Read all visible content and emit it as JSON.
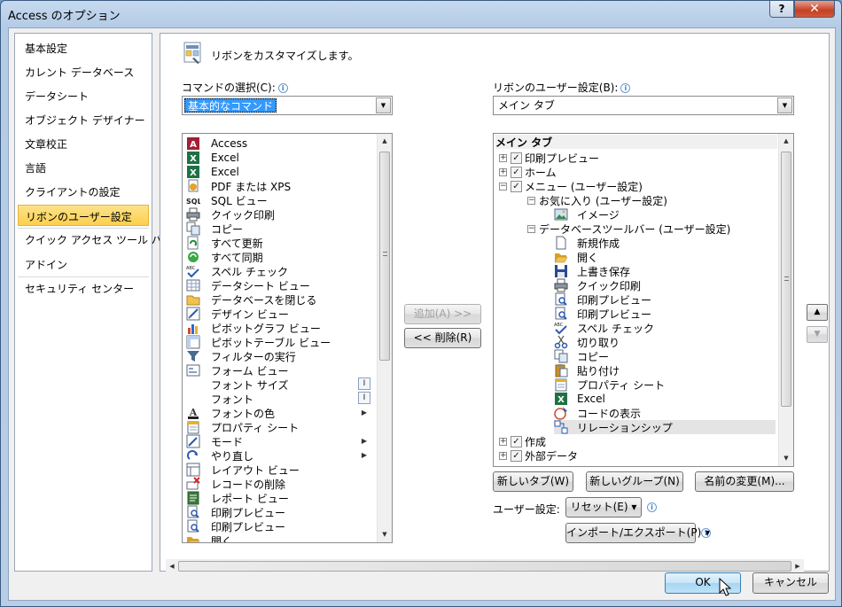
{
  "window": {
    "title": "Access のオプション",
    "help": "?",
    "close": "✕"
  },
  "nav": {
    "items": [
      {
        "label": "基本設定",
        "selected": false
      },
      {
        "label": "カレント データベース",
        "selected": false
      },
      {
        "label": "データシート",
        "selected": false
      },
      {
        "label": "オブジェクト デザイナー",
        "selected": false
      },
      {
        "label": "文章校正",
        "selected": false
      },
      {
        "label": "言語",
        "selected": false
      },
      {
        "label": "クライアントの設定",
        "selected": false
      },
      {
        "label": "リボンのユーザー設定",
        "selected": true
      },
      {
        "label": "クイック アクセス ツール バー",
        "selected": false
      },
      {
        "label": "アドイン",
        "selected": false
      },
      {
        "label": "セキュリティ センター",
        "selected": false
      }
    ]
  },
  "header": {
    "text": "リボンをカスタマイズします。"
  },
  "commands": {
    "label": "コマンドの選択(C):",
    "selected": "基本的なコマンド",
    "items": [
      {
        "label": "Access",
        "icon": "access-icon",
        "sub": ""
      },
      {
        "label": "Excel",
        "icon": "excel-icon",
        "sub": ""
      },
      {
        "label": "Excel",
        "icon": "excel-icon",
        "sub": ""
      },
      {
        "label": "PDF または XPS",
        "icon": "pdf-xps-icon",
        "sub": ""
      },
      {
        "label": "SQL ビュー",
        "icon": "sql-icon",
        "sub": ""
      },
      {
        "label": "クイック印刷",
        "icon": "quick-print-icon",
        "sub": ""
      },
      {
        "label": "コピー",
        "icon": "copy-icon",
        "sub": ""
      },
      {
        "label": "すべて更新",
        "icon": "refresh-all-icon",
        "sub": ""
      },
      {
        "label": "すべて同期",
        "icon": "sync-all-icon",
        "sub": ""
      },
      {
        "label": "スペル チェック",
        "icon": "spell-check-icon",
        "sub": ""
      },
      {
        "label": "データシート ビュー",
        "icon": "datasheet-icon",
        "sub": ""
      },
      {
        "label": "データベースを閉じる",
        "icon": "close-db-icon",
        "sub": ""
      },
      {
        "label": "デザイン ビュー",
        "icon": "design-view-icon",
        "sub": ""
      },
      {
        "label": "ピボットグラフ ビュー",
        "icon": "pivot-chart-icon",
        "sub": ""
      },
      {
        "label": "ピボットテーブル ビュー",
        "icon": "pivot-table-icon",
        "sub": ""
      },
      {
        "label": "フィルターの実行",
        "icon": "filter-icon",
        "sub": ""
      },
      {
        "label": "フォーム ビュー",
        "icon": "form-view-icon",
        "sub": ""
      },
      {
        "label": "フォント サイズ",
        "icon": "",
        "sub": "box"
      },
      {
        "label": "フォント",
        "icon": "",
        "sub": "box"
      },
      {
        "label": "フォントの色",
        "icon": "font-color-icon",
        "sub": "arrow"
      },
      {
        "label": "プロパティ シート",
        "icon": "property-sheet-icon",
        "sub": ""
      },
      {
        "label": "モード",
        "icon": "mode-icon",
        "sub": "arrow"
      },
      {
        "label": "やり直し",
        "icon": "redo-icon",
        "sub": "arrow"
      },
      {
        "label": "レイアウト ビュー",
        "icon": "layout-view-icon",
        "sub": ""
      },
      {
        "label": "レコードの削除",
        "icon": "delete-record-icon",
        "sub": ""
      },
      {
        "label": "レポート ビュー",
        "icon": "report-view-icon",
        "sub": ""
      },
      {
        "label": "印刷プレビュー",
        "icon": "print-preview-icon",
        "sub": ""
      },
      {
        "label": "印刷プレビュー",
        "icon": "print-preview-icon",
        "sub": ""
      },
      {
        "label": "開く",
        "icon": "open-icon",
        "sub": ""
      }
    ]
  },
  "middle": {
    "add": "追加(A) >>",
    "remove": "<< 削除(R)"
  },
  "ribbon": {
    "label": "リボンのユーザー設定(B):",
    "selected": "メイン タブ",
    "tree_header": "メイン タブ",
    "tree": [
      {
        "label": "印刷プレビュー",
        "level": 0,
        "exp": "+",
        "check": true,
        "icon": "",
        "hl": false
      },
      {
        "label": "ホーム",
        "level": 0,
        "exp": "+",
        "check": true,
        "icon": "",
        "hl": false
      },
      {
        "label": "メニュー (ユーザー設定)",
        "level": 0,
        "exp": "−",
        "check": true,
        "icon": "",
        "hl": false
      },
      {
        "label": "お気に入り (ユーザー設定)",
        "level": 1,
        "exp": "−",
        "check": null,
        "icon": "",
        "hl": false
      },
      {
        "label": "イメージ",
        "level": 2,
        "exp": "",
        "check": null,
        "icon": "image-icon",
        "hl": false
      },
      {
        "label": "データベースツールバー (ユーザー設定)",
        "level": 1,
        "exp": "−",
        "check": null,
        "icon": "",
        "hl": false
      },
      {
        "label": "新規作成",
        "level": 2,
        "exp": "",
        "check": null,
        "icon": "new-icon",
        "hl": false
      },
      {
        "label": "開く",
        "level": 2,
        "exp": "",
        "check": null,
        "icon": "open-icon",
        "hl": false
      },
      {
        "label": "上書き保存",
        "level": 2,
        "exp": "",
        "check": null,
        "icon": "save-icon",
        "hl": false
      },
      {
        "label": "クイック印刷",
        "level": 2,
        "exp": "",
        "check": null,
        "icon": "quick-print-icon",
        "hl": false
      },
      {
        "label": "印刷プレビュー",
        "level": 2,
        "exp": "",
        "check": null,
        "icon": "print-preview-icon",
        "hl": false
      },
      {
        "label": "印刷プレビュー",
        "level": 2,
        "exp": "",
        "check": null,
        "icon": "print-preview-icon",
        "hl": false
      },
      {
        "label": "スペル チェック",
        "level": 2,
        "exp": "",
        "check": null,
        "icon": "spell-check-icon",
        "hl": false
      },
      {
        "label": "切り取り",
        "level": 2,
        "exp": "",
        "check": null,
        "icon": "cut-icon",
        "hl": false
      },
      {
        "label": "コピー",
        "level": 2,
        "exp": "",
        "check": null,
        "icon": "copy-icon",
        "hl": false
      },
      {
        "label": "貼り付け",
        "level": 2,
        "exp": "",
        "check": null,
        "icon": "paste-icon",
        "hl": false
      },
      {
        "label": "プロパティ シート",
        "level": 2,
        "exp": "",
        "check": null,
        "icon": "property-sheet-icon",
        "hl": false
      },
      {
        "label": "Excel",
        "level": 2,
        "exp": "",
        "check": null,
        "icon": "excel-icon",
        "hl": false
      },
      {
        "label": "コードの表示",
        "level": 2,
        "exp": "",
        "check": null,
        "icon": "view-code-icon",
        "hl": false
      },
      {
        "label": "リレーションシップ",
        "level": 2,
        "exp": "",
        "check": null,
        "icon": "relationships-icon",
        "hl": true
      },
      {
        "label": "作成",
        "level": 0,
        "exp": "+",
        "check": true,
        "icon": "",
        "hl": false
      },
      {
        "label": "外部データ",
        "level": 0,
        "exp": "+",
        "check": true,
        "icon": "",
        "hl": false
      }
    ]
  },
  "tree_buttons": {
    "new_tab": "新しいタブ(W)",
    "new_group": "新しいグループ(N)",
    "rename": "名前の変更(M)..."
  },
  "customize": {
    "label": "ユーザー設定:",
    "reset": "リセット(E) ▾",
    "import_export": "インポート/エクスポート(P) ▾"
  },
  "footer": {
    "ok": "OK",
    "cancel": "キャンセル"
  }
}
